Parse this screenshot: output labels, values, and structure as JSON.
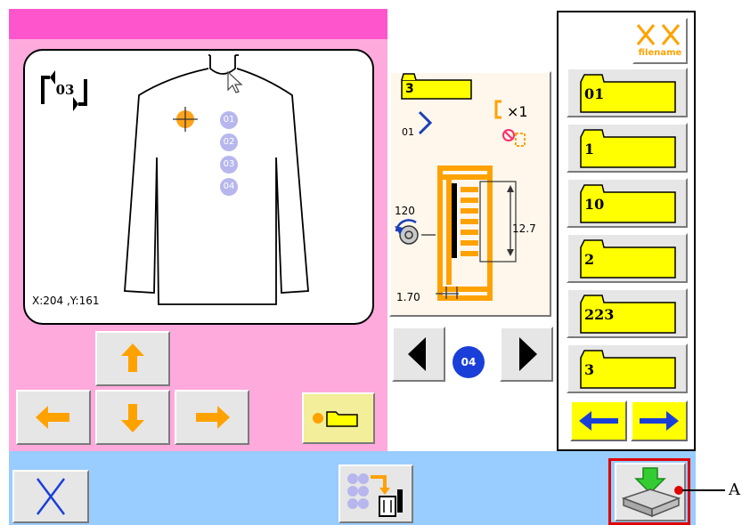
{
  "pattern_no": "03",
  "coords": "X:204 ,Y:161",
  "stitch_points": [
    "01",
    "02",
    "03",
    "04"
  ],
  "file_box_value": "3",
  "repeat_label": "×1",
  "start_point": "01",
  "angle": "120",
  "height_value": "12.7",
  "width_value": "1.70",
  "current_point": "04",
  "filename_label": "filename",
  "folders": [
    "01",
    "1",
    "10",
    "2",
    "223",
    "3"
  ],
  "callout_label": "A",
  "colors": {
    "pink": "#ffaadd",
    "blue_bar": "#99ccff",
    "yellow": "#ffff00",
    "orange": "#ffb300",
    "callout": "#e00000"
  }
}
